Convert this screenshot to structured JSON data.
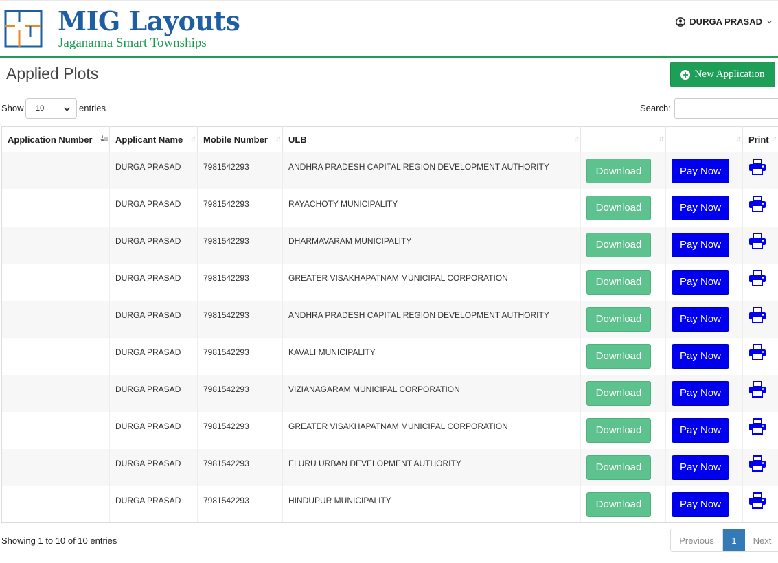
{
  "header": {
    "brand_title": "MIG Layouts",
    "brand_subtitle": "Jagananna Smart Townships",
    "user_name": "DURGA PRASAD",
    "colors": {
      "brand_blue": "#1e5ea3",
      "brand_green": "#1a9a52",
      "accent_orange": "#e88a2a"
    }
  },
  "page": {
    "title": "Applied Plots",
    "new_application_label": "New Application"
  },
  "controls": {
    "show_label": "Show",
    "entries_value": "10",
    "entries_label": "entries",
    "search_label": "Search:",
    "search_value": ""
  },
  "table": {
    "columns": [
      "Application Number",
      "Applicant Name",
      "Mobile Number",
      "ULB",
      "",
      "",
      "Print"
    ],
    "download_label": "Download",
    "pay_label": "Pay Now",
    "rows": [
      {
        "app_no": "",
        "name": "DURGA PRASAD",
        "mobile": "7981542293",
        "ulb": "ANDHRA PRADESH CAPITAL REGION DEVELOPMENT AUTHORITY"
      },
      {
        "app_no": "",
        "name": "DURGA PRASAD",
        "mobile": "7981542293",
        "ulb": "RAYACHOTY MUNICIPALITY"
      },
      {
        "app_no": "",
        "name": "DURGA PRASAD",
        "mobile": "7981542293",
        "ulb": "DHARMAVARAM MUNICIPALITY"
      },
      {
        "app_no": "",
        "name": "DURGA PRASAD",
        "mobile": "7981542293",
        "ulb": "GREATER VISAKHAPATNAM MUNICIPAL CORPORATION"
      },
      {
        "app_no": "",
        "name": "DURGA PRASAD",
        "mobile": "7981542293",
        "ulb": "ANDHRA PRADESH CAPITAL REGION DEVELOPMENT AUTHORITY"
      },
      {
        "app_no": "",
        "name": "DURGA PRASAD",
        "mobile": "7981542293",
        "ulb": "KAVALI MUNICIPALITY"
      },
      {
        "app_no": "",
        "name": "DURGA PRASAD",
        "mobile": "7981542293",
        "ulb": "VIZIANAGARAM MUNICIPAL CORPORATION"
      },
      {
        "app_no": "",
        "name": "DURGA PRASAD",
        "mobile": "7981542293",
        "ulb": "GREATER VISAKHAPATNAM MUNICIPAL CORPORATION"
      },
      {
        "app_no": "",
        "name": "DURGA PRASAD",
        "mobile": "7981542293",
        "ulb": "ELURU URBAN DEVELOPMENT AUTHORITY"
      },
      {
        "app_no": "",
        "name": "DURGA PRASAD",
        "mobile": "7981542293",
        "ulb": "HINDUPUR MUNICIPALITY"
      }
    ]
  },
  "footer": {
    "info": "Showing 1 to 10 of 10 entries",
    "previous_label": "Previous",
    "current_page": "1",
    "next_label": "Next"
  },
  "icons": {
    "logo": "floorplan-logo-icon",
    "user": "user-circle-icon",
    "dropdown": "chevron-down-icon",
    "new": "plus-circle-icon",
    "sort": "sort-icon",
    "print": "printer-icon"
  }
}
